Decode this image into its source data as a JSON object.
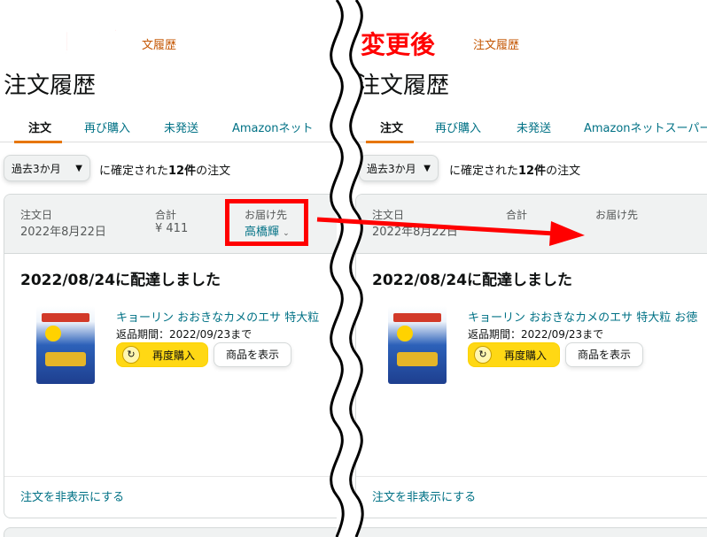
{
  "labels": {
    "before": "変更前",
    "after": "変更後"
  },
  "colors": {
    "accent": "#ff0000",
    "link": "#007185",
    "button_primary": "#ffd814",
    "tab_underline": "#e77600"
  },
  "panel_before": {
    "breadcrumb": "文履歴",
    "title": "注文履歴",
    "tabs": [
      "注文",
      "再び購入",
      "未発送",
      "Amazonネット"
    ],
    "filter": {
      "select_value": "過去3か月",
      "text_prefix": "に確定された",
      "count": "12件",
      "text_suffix": "の注文"
    },
    "order": {
      "date_label": "注文日",
      "date_value": "2022年8月22日",
      "total_label": "合計",
      "total_value": "¥ 411",
      "ship_label": "お届け先",
      "ship_value": "高橋輝",
      "status": "2022/08/24に配達しました",
      "product_title": "キョーリン おおきなカメのエサ 特大粒",
      "return_text": "返品期間：2022/09/23まで",
      "rebuy_label": "再度購入",
      "view_label": "商品を表示",
      "hide_link": "注文を非表示にする"
    }
  },
  "panel_after": {
    "breadcrumb": "注文履歴",
    "title": "注文履歴",
    "tabs": [
      "注文",
      "再び購入",
      "未発送",
      "Amazonネットスーパー"
    ],
    "filter": {
      "select_value": "過去3か月",
      "text_prefix": "に確定された",
      "count": "12件",
      "text_suffix": "の注文"
    },
    "order": {
      "date_label": "注文日",
      "date_value": "2022年8月22日",
      "total_label": "合計",
      "ship_label": "お届け先",
      "status": "2022/08/24に配達しました",
      "product_title": "キョーリン おおきなカメのエサ 特大粒 お徳",
      "return_text": "返品期間：2022/09/23まで",
      "rebuy_label": "再度購入",
      "view_label": "商品を表示",
      "hide_link": "注文を非表示にする"
    }
  }
}
